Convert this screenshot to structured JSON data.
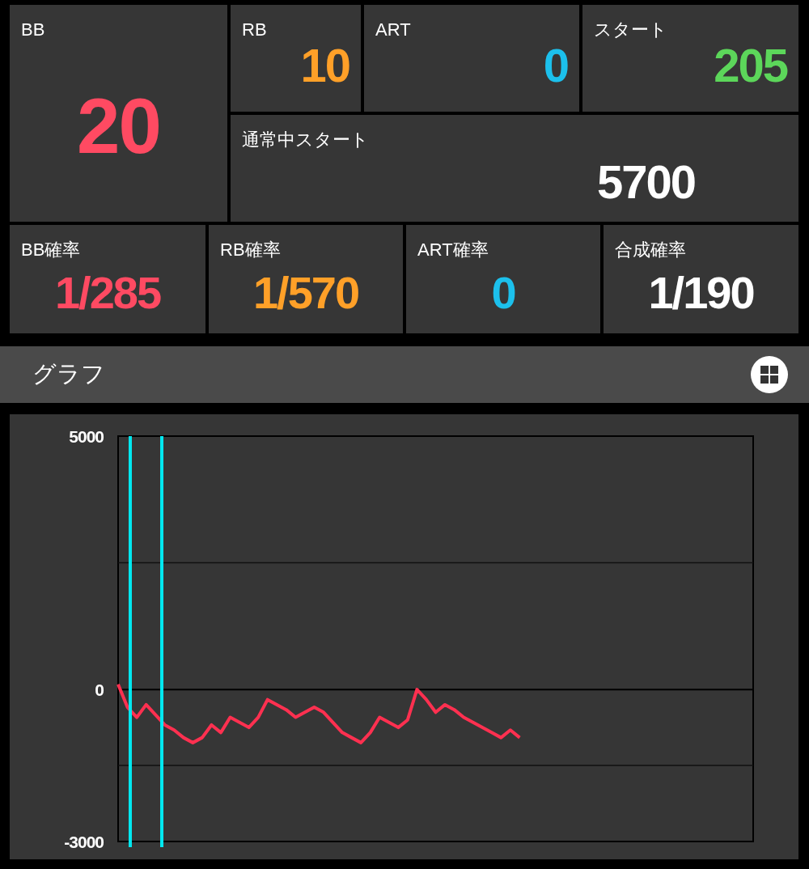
{
  "top_stats": [
    {
      "kind": "big",
      "label": "BB",
      "value": "20",
      "color": "#ff4a62"
    },
    {
      "kind": "small",
      "label": "RB",
      "value": "10",
      "color": "#ffa028"
    },
    {
      "kind": "small",
      "label": "ART",
      "value": "0",
      "color": "#1cc0ec"
    },
    {
      "kind": "small",
      "label": "スタート",
      "value": "205",
      "color": "#5cd65a"
    },
    {
      "kind": "wide",
      "label": "通常中スタート",
      "value": "5700",
      "color": "#ffffff"
    }
  ],
  "rates": [
    {
      "label": "BB確率",
      "value": "1/285",
      "color": "#ff4a62"
    },
    {
      "label": "RB確率",
      "value": "1/570",
      "color": "#ffa028"
    },
    {
      "label": "ART確率",
      "value": "0",
      "color": "#1cc0ec"
    },
    {
      "label": "合成確率",
      "value": "1/190",
      "color": "#ffffff"
    }
  ],
  "graph_header": {
    "title": "グラフ"
  },
  "graph": {
    "chart_data": {
      "type": "line",
      "ylim": [
        -3000,
        5000
      ],
      "yticks": [
        5000,
        0,
        -3000
      ],
      "ref_lines": [
        {
          "axis": "y",
          "value": 2500
        },
        {
          "axis": "y",
          "value": -1500
        }
      ],
      "categories": [
        null,
        null,
        null,
        null,
        null,
        null,
        null,
        null,
        null,
        null,
        null,
        null,
        null,
        null,
        null,
        null,
        null,
        null,
        null,
        null,
        null,
        null,
        null,
        null,
        null,
        null,
        null,
        null,
        null,
        null,
        null,
        null,
        null,
        null,
        null,
        null,
        null,
        null,
        null,
        null,
        null,
        null,
        null,
        null,
        null,
        null,
        null,
        null,
        null,
        null,
        null,
        null,
        null,
        null,
        null,
        null,
        null,
        null,
        null,
        null,
        null,
        null,
        null,
        null,
        null,
        null,
        null,
        null,
        null
      ],
      "series": [
        {
          "color": "#ff3050",
          "values": [
            100,
            -350,
            -550,
            -300,
            -500,
            -700,
            -800,
            -950,
            -1050,
            -950,
            -700,
            -850,
            -550,
            -650,
            -750,
            -550,
            -200,
            -300,
            -400,
            -550,
            -450,
            -350,
            -450,
            -650,
            -850,
            -950,
            -1050,
            -850,
            -550,
            -650,
            -750,
            -600,
            0,
            -200,
            -450,
            -300,
            -400,
            -550,
            -650,
            -750,
            -850,
            -950,
            -800,
            -950,
            null,
            null,
            null,
            null,
            null,
            null,
            null,
            null,
            null,
            null,
            null,
            null,
            null,
            null,
            null,
            null,
            null,
            null,
            null,
            null,
            null,
            null,
            null,
            null,
            null
          ]
        }
      ]
    }
  }
}
